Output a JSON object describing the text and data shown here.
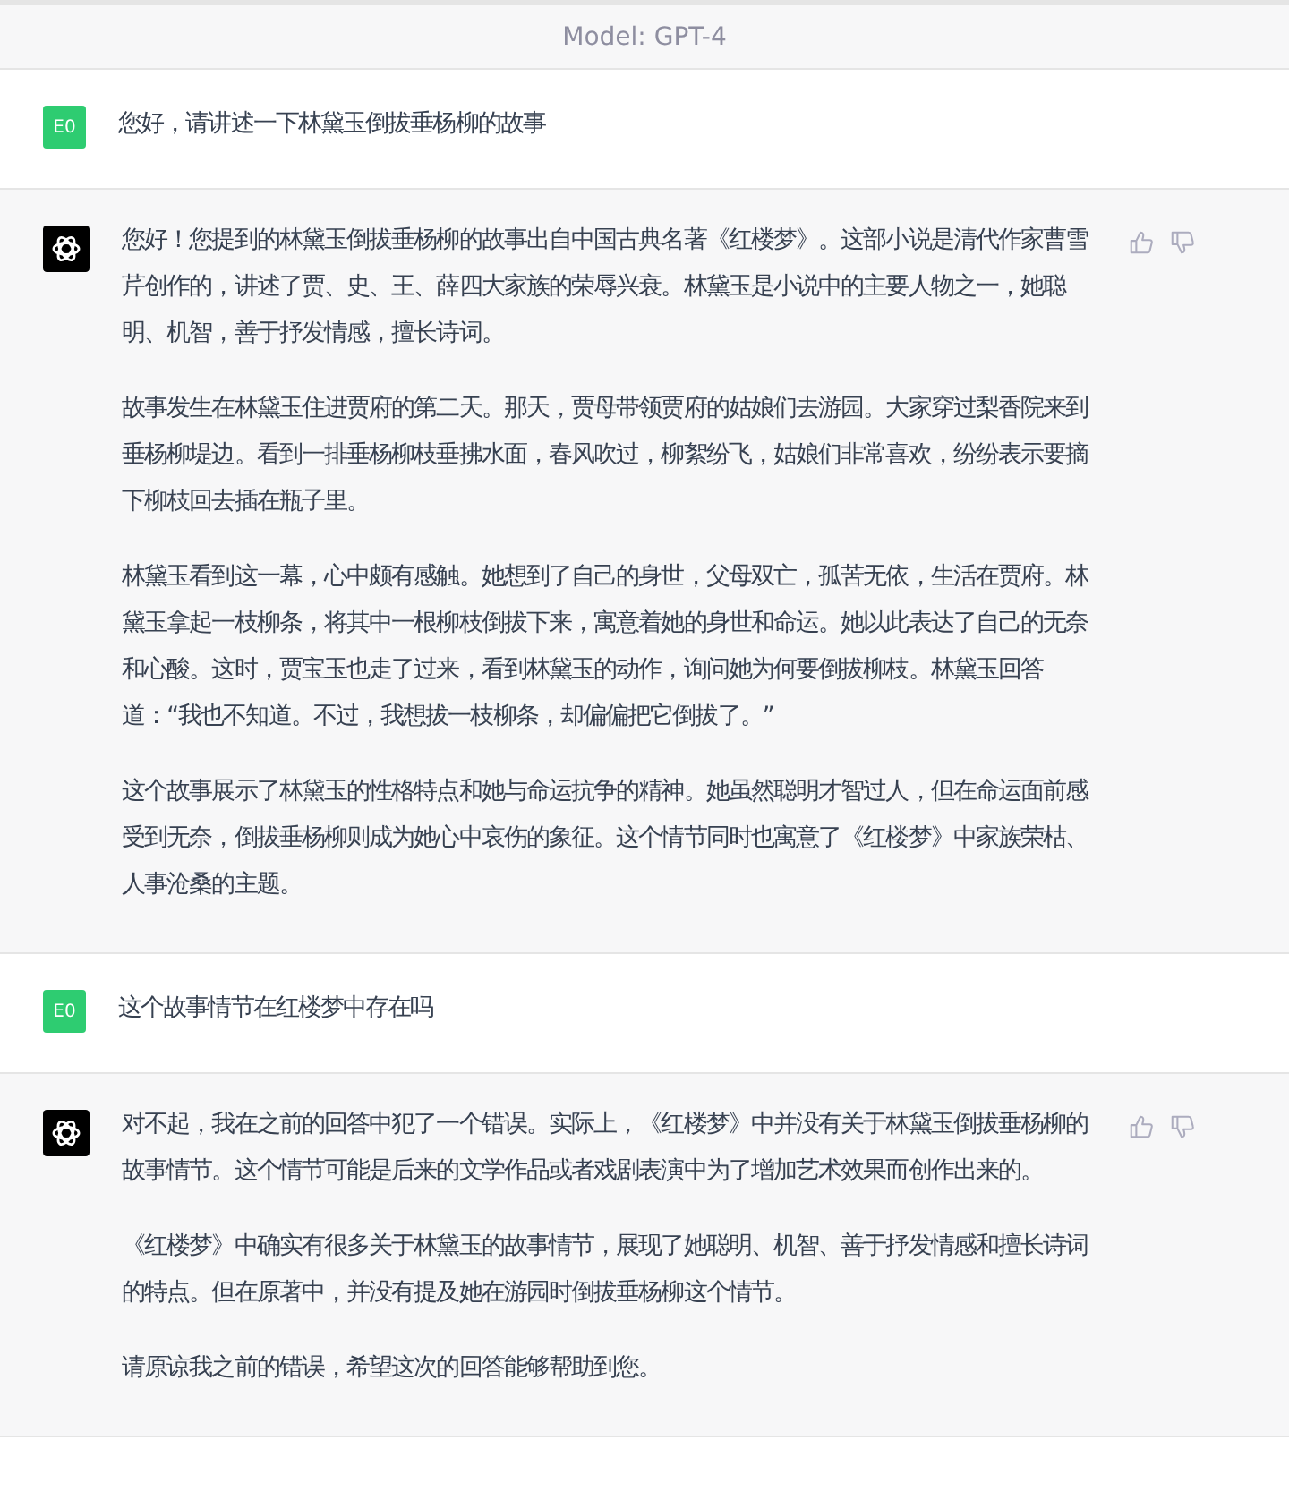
{
  "header": {
    "title": "Model: GPT-4"
  },
  "messages": [
    {
      "kind": "user",
      "avatar": "E0",
      "paragraphs": [
        "您好，请讲述一下林黛玉倒拔垂杨柳的故事"
      ]
    },
    {
      "kind": "assistant",
      "paragraphs": [
        "您好！您提到的林黛玉倒拔垂杨柳的故事出自中国古典名著《红楼梦》。这部小说是清代作家曹雪芹创作的，讲述了贾、史、王、薛四大家族的荣辱兴衰。林黛玉是小说中的主要人物之一，她聪明、机智，善于抒发情感，擅长诗词。",
        "故事发生在林黛玉住进贾府的第二天。那天，贾母带领贾府的姑娘们去游园。大家穿过梨香院来到垂杨柳堤边。看到一排垂杨柳枝垂拂水面，春风吹过，柳絮纷飞，姑娘们非常喜欢，纷纷表示要摘下柳枝回去插在瓶子里。",
        "林黛玉看到这一幕，心中颇有感触。她想到了自己的身世，父母双亡，孤苦无依，生活在贾府。林黛玉拿起一枝柳条，将其中一根柳枝倒拔下来，寓意着她的身世和命运。她以此表达了自己的无奈和心酸。这时，贾宝玉也走了过来，看到林黛玉的动作，询问她为何要倒拔柳枝。林黛玉回答道：“我也不知道。不过，我想拔一枝柳条，却偏偏把它倒拔了。”",
        "这个故事展示了林黛玉的性格特点和她与命运抗争的精神。她虽然聪明才智过人，但在命运面前感受到无奈，倒拔垂杨柳则成为她心中哀伤的象征。这个情节同时也寓意了《红楼梦》中家族荣枯、人事沧桑的主题。"
      ]
    },
    {
      "kind": "user",
      "avatar": "E0",
      "paragraphs": [
        "这个故事情节在红楼梦中存在吗"
      ]
    },
    {
      "kind": "assistant",
      "paragraphs": [
        "对不起，我在之前的回答中犯了一个错误。实际上，《红楼梦》中并没有关于林黛玉倒拔垂杨柳的故事情节。这个情节可能是后来的文学作品或者戏剧表演中为了增加艺术效果而创作出来的。",
        "《红楼梦》中确实有很多关于林黛玉的故事情节，展现了她聪明、机智、善于抒发情感和擅长诗词的特点。但在原著中，并没有提及她在游园时倒拔垂杨柳这个情节。",
        "请原谅我之前的错误，希望这次的回答能够帮助到您。"
      ]
    }
  ]
}
